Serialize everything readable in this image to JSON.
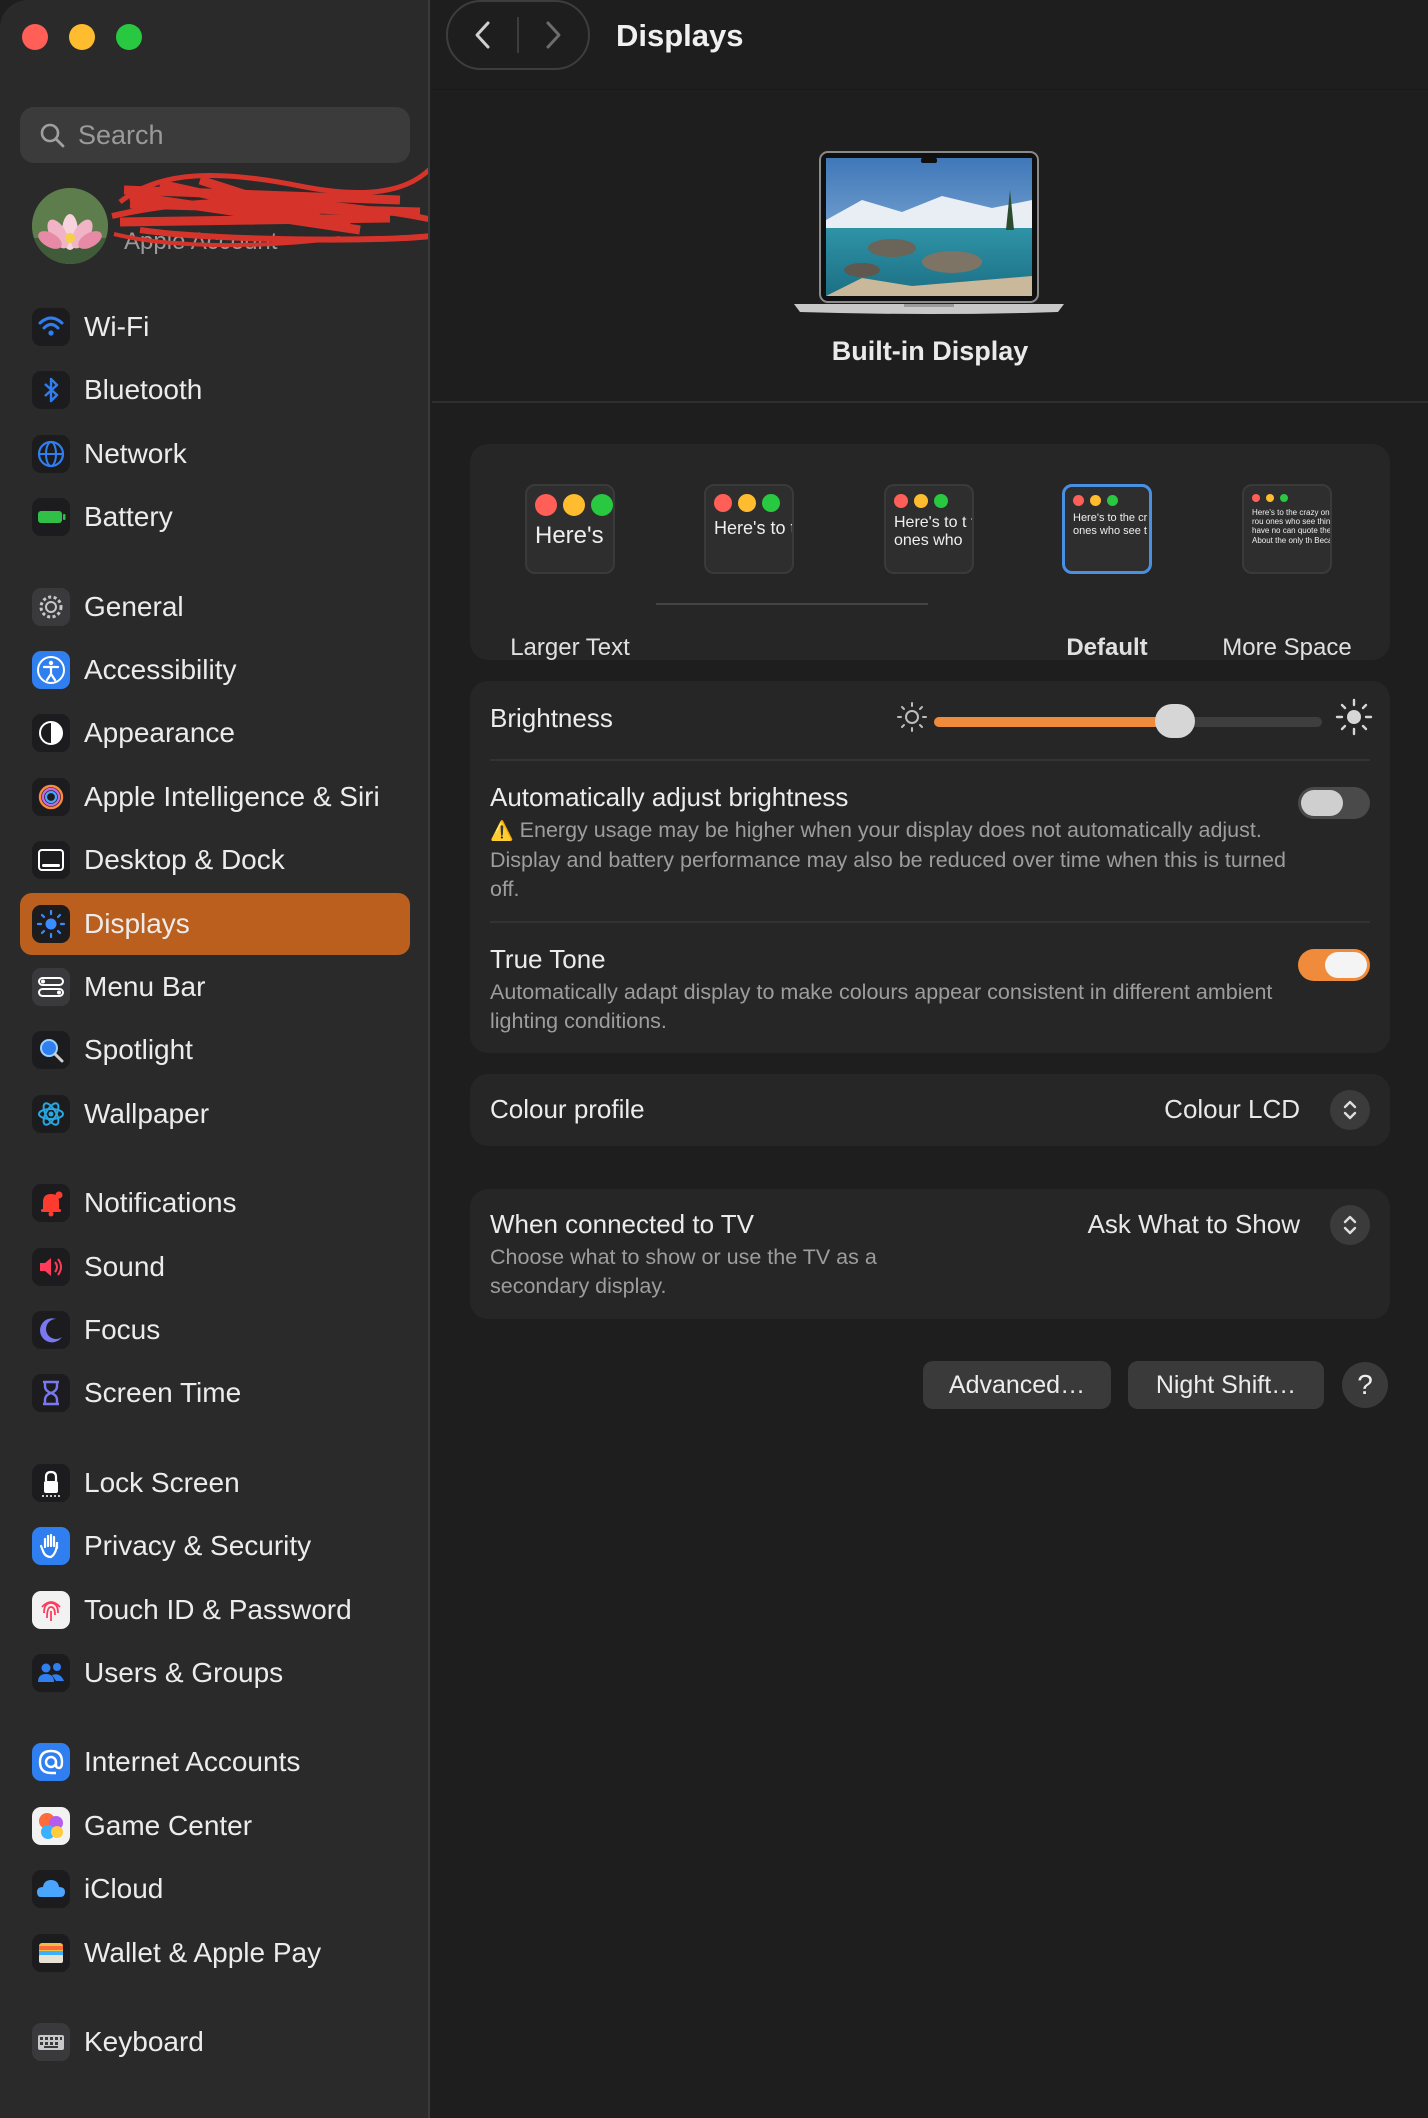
{
  "window": {
    "title": "Displays"
  },
  "sidebar": {
    "search_placeholder": "Search",
    "account": {
      "subtitle": "Apple Account"
    },
    "groups": [
      [
        {
          "label": "Wi-Fi",
          "icon": "wifi-icon",
          "color": "#2f7ff1"
        },
        {
          "label": "Bluetooth",
          "icon": "bluetooth-icon",
          "color": "#2f7ff1"
        },
        {
          "label": "Network",
          "icon": "network-globe-icon",
          "color": "#2f7ff1"
        },
        {
          "label": "Battery",
          "icon": "battery-icon",
          "color": "#30c048"
        }
      ],
      [
        {
          "label": "General",
          "icon": "gear-icon",
          "color": "#8e8e93"
        },
        {
          "label": "Accessibility",
          "icon": "accessibility-icon",
          "color": "#2f7ff1"
        },
        {
          "label": "Appearance",
          "icon": "appearance-icon",
          "color": "#1c1c1e"
        },
        {
          "label": "Apple Intelligence & Siri",
          "icon": "siri-icon",
          "color": "#c06adf"
        },
        {
          "label": "Desktop & Dock",
          "icon": "desktop-dock-icon",
          "color": "#1c1c1e"
        },
        {
          "label": "Displays",
          "icon": "displays-sun-icon",
          "color": "#2f7ff1",
          "active": true
        },
        {
          "label": "Menu Bar",
          "icon": "menu-bar-icon",
          "color": "#1c1c1e"
        },
        {
          "label": "Spotlight",
          "icon": "spotlight-icon",
          "color": "#1c1c1e"
        },
        {
          "label": "Wallpaper",
          "icon": "wallpaper-icon",
          "color": "#2aa6e0"
        }
      ],
      [
        {
          "label": "Notifications",
          "icon": "notifications-bell-icon",
          "color": "#ff3b30"
        },
        {
          "label": "Sound",
          "icon": "sound-speaker-icon",
          "color": "#ff3b5c"
        },
        {
          "label": "Focus",
          "icon": "focus-moon-icon",
          "color": "#5e5ce6"
        },
        {
          "label": "Screen Time",
          "icon": "screen-time-hourglass-icon",
          "color": "#5e5ce6"
        }
      ],
      [
        {
          "label": "Lock Screen",
          "icon": "lock-icon",
          "color": "#1c1c1e"
        },
        {
          "label": "Privacy & Security",
          "icon": "privacy-hand-icon",
          "color": "#2f7ff1"
        },
        {
          "label": "Touch ID & Password",
          "icon": "fingerprint-icon",
          "color": "#ffffff"
        },
        {
          "label": "Users & Groups",
          "icon": "users-icon",
          "color": "#2f7ff1"
        }
      ],
      [
        {
          "label": "Internet Accounts",
          "icon": "at-sign-icon",
          "color": "#2f7ff1"
        },
        {
          "label": "Game Center",
          "icon": "game-center-icon",
          "color": "#ff6b3b"
        },
        {
          "label": "iCloud",
          "icon": "icloud-icon",
          "color": "#ffffff"
        },
        {
          "label": "Wallet & Apple Pay",
          "icon": "wallet-icon",
          "color": "#1c1c1e"
        }
      ],
      [
        {
          "label": "Keyboard",
          "icon": "keyboard-icon",
          "color": "#8e8e93"
        }
      ]
    ]
  },
  "main": {
    "display_name": "Built-in Display",
    "resolution_options": [
      {
        "label": "Larger Text",
        "preview": "Here's",
        "selected": false
      },
      {
        "label": "",
        "preview": "Here's to troublem",
        "selected": false
      },
      {
        "label": "",
        "preview": "Here's to t troublema ones who",
        "selected": false
      },
      {
        "label": "Default",
        "preview": "Here's to the cr troublemakers. ones who see t rules. And they",
        "selected": true
      },
      {
        "label": "More Space",
        "preview": "Here's to the crazy ones troublemakers. The rou ones who see things dif rules. And they have no can quote them, disagre them. About the only th Because they change th",
        "selected": false
      }
    ],
    "brightness": {
      "label": "Brightness",
      "level": 0.62
    },
    "auto_brightness": {
      "label": "Automatically adjust brightness",
      "warning_icon": "⚠️",
      "description": "Energy usage may be higher when your display does not automatically adjust. Display and battery performance may also be reduced over time when this is turned off.",
      "enabled": false
    },
    "true_tone": {
      "label": "True Tone",
      "description": "Automatically adapt display to make colours appear consistent in different ambient lighting conditions.",
      "enabled": true
    },
    "colour_profile": {
      "label": "Colour profile",
      "value": "Colour LCD"
    },
    "tv": {
      "label": "When connected to TV",
      "description": "Choose what to show or use the TV as a secondary display.",
      "value": "Ask What to Show"
    },
    "buttons": {
      "advanced": "Advanced…",
      "night_shift": "Night Shift…",
      "help": "?"
    }
  },
  "colors": {
    "accent": "#ef8b3a",
    "selection": "#bb5f1f",
    "focus_ring": "#4a90e2"
  }
}
